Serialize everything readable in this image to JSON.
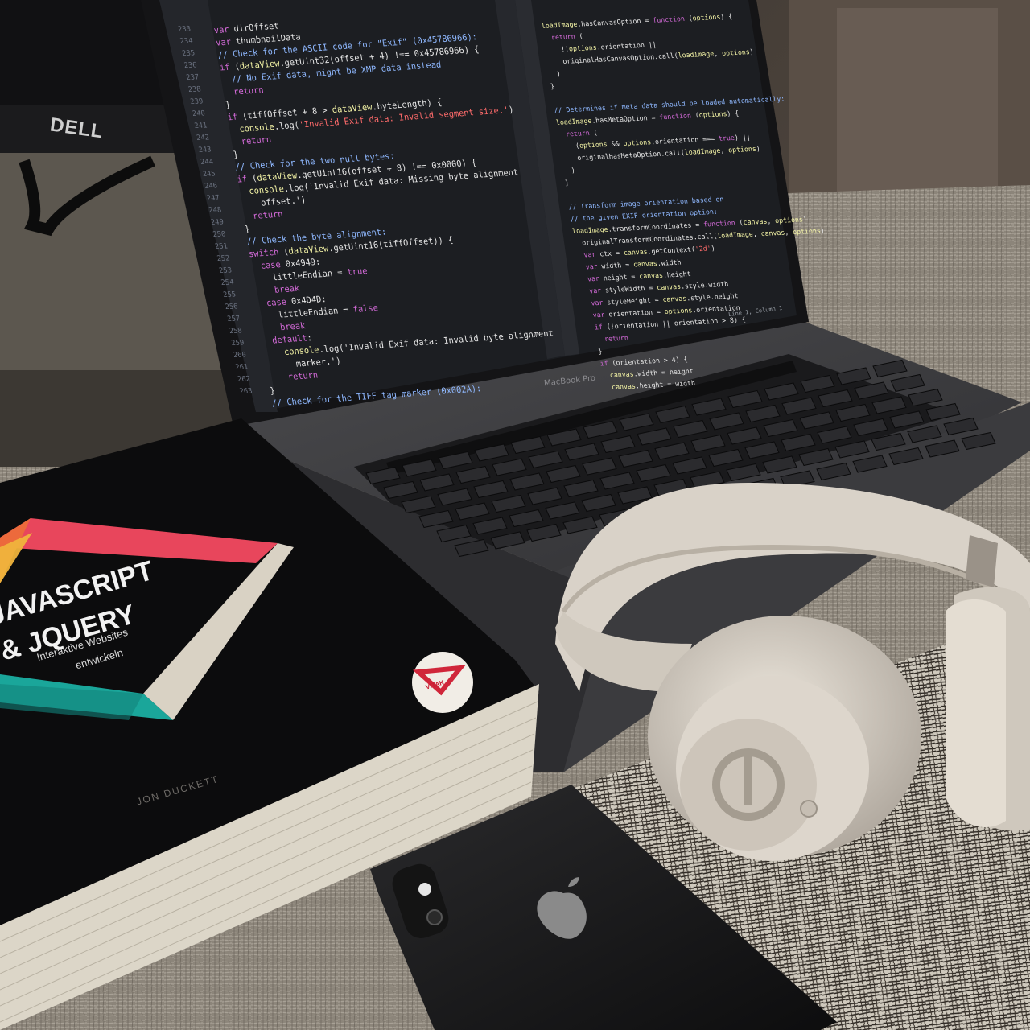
{
  "monitor": {
    "brand": "DELL"
  },
  "laptop": {
    "model_label": "MacBook Pro",
    "editor_left": {
      "line_numbers": [
        "233",
        "234",
        "235",
        "236",
        "237",
        "238",
        "239",
        "240",
        "241",
        "242",
        "243",
        "244",
        "245",
        "246",
        "247",
        "248",
        "249",
        "250",
        "251",
        "252",
        "253",
        "254",
        "255",
        "256",
        "257",
        "258",
        "259",
        "260",
        "261",
        "262",
        "263"
      ],
      "lines": [
        "var dirOffset",
        "var thumbnailData",
        "// Check for the ASCII code for \"Exif\" (0x45786966):",
        "if (dataView.getUint32(offset + 4) !== 0x45786966) {",
        "  // No Exif data, might be XMP data instead",
        "  return",
        "}",
        "if (tiffOffset + 8 > dataView.byteLength) {",
        "  console.log('Invalid Exif data: Invalid segment size.')",
        "  return",
        "}",
        "// Check for the two null bytes:",
        "if (dataView.getUint16(offset + 8) !== 0x0000) {",
        "  console.log('Invalid Exif data: Missing byte alignment",
        "    offset.')",
        "  return",
        "}",
        "// Check the byte alignment:",
        "switch (dataView.getUint16(tiffOffset)) {",
        "  case 0x4949:",
        "    littleEndian = true",
        "    break",
        "  case 0x4D4D:",
        "    littleEndian = false",
        "    break",
        "  default:",
        "    console.log('Invalid Exif data: Invalid byte alignment",
        "      marker.')",
        "    return",
        "}",
        "// Check for the TIFF tag marker (0x002A):"
      ]
    },
    "editor_right": {
      "lines": [
        "loadImage.hasCanvasOption = function (options) {",
        "  return (",
        "    !!options.orientation ||",
        "    originalHasCanvasOption.call(loadImage, options)",
        "  )",
        "}",
        "",
        "// Determines if meta data should be loaded automatically:",
        "loadImage.hasMetaOption = function (options) {",
        "  return (",
        "    (options && options.orientation === true) ||",
        "    originalHasMetaOption.call(loadImage, options)",
        "  )",
        "}",
        "",
        "// Transform image orientation based on",
        "// the given EXIF orientation option:",
        "loadImage.transformCoordinates = function (canvas, options)",
        "  originalTransformCoordinates.call(loadImage, canvas, options)",
        "  var ctx = canvas.getContext('2d')",
        "  var width = canvas.width",
        "  var height = canvas.height",
        "  var styleWidth = canvas.style.width",
        "  var styleHeight = canvas.style.height",
        "  var orientation = options.orientation",
        "  if (!orientation || orientation > 8) {",
        "    return",
        "  }",
        "  if (orientation > 4) {",
        "    canvas.width = height",
        "    canvas.height = width"
      ]
    },
    "status_bar_text": "Line 1, Column 1"
  },
  "book": {
    "title_line1": "JAVASCRIPT",
    "title_line2": "& JQUERY",
    "subtitle_line1": "Interaktive Websites",
    "subtitle_line2": "entwickeln",
    "author": "JON DUCKETT",
    "badge": "VITAK"
  },
  "colors": {
    "book_frame_red": "#e8465c",
    "book_frame_teal": "#1aa69a",
    "book_frame_yellow": "#f0b43c",
    "book_frame_orange": "#ec6a3c",
    "headphones": "#d9d2c8",
    "desk": "#8a8378"
  }
}
